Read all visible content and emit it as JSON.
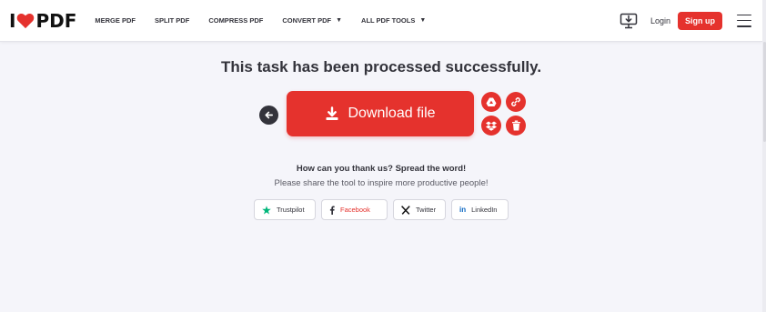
{
  "header": {
    "logo": {
      "left": "I",
      "right": "PDF"
    },
    "nav": [
      {
        "label": "MERGE PDF",
        "dropdown": false
      },
      {
        "label": "SPLIT PDF",
        "dropdown": false
      },
      {
        "label": "COMPRESS PDF",
        "dropdown": false
      },
      {
        "label": "CONVERT PDF",
        "dropdown": true
      },
      {
        "label": "ALL PDF TOOLS",
        "dropdown": true
      }
    ],
    "caret": "▼",
    "login": "Login",
    "signup": "Sign up",
    "desktop_icon": "desktop-download-icon",
    "menu_icon": "hamburger-menu-icon"
  },
  "main": {
    "title": "This task has been processed successfully.",
    "download_label": "Download file",
    "share_title": "How can you thank us? Spread the word!",
    "share_subtitle": "Please share the tool to inspire more productive people!",
    "social": [
      {
        "label": "Trustpilot",
        "icon": "star-icon",
        "color": "#00b67a"
      },
      {
        "label": "Facebook",
        "icon": "facebook-icon",
        "color": "#e5322d"
      },
      {
        "label": "Twitter",
        "icon": "x-icon",
        "color": "#111111"
      },
      {
        "label": "LinkedIn",
        "icon": "linkedin-icon",
        "color": "#0a66c2"
      }
    ]
  },
  "colors": {
    "brand": "#e5322d",
    "text": "#33333b",
    "background": "#f5f5fa"
  }
}
